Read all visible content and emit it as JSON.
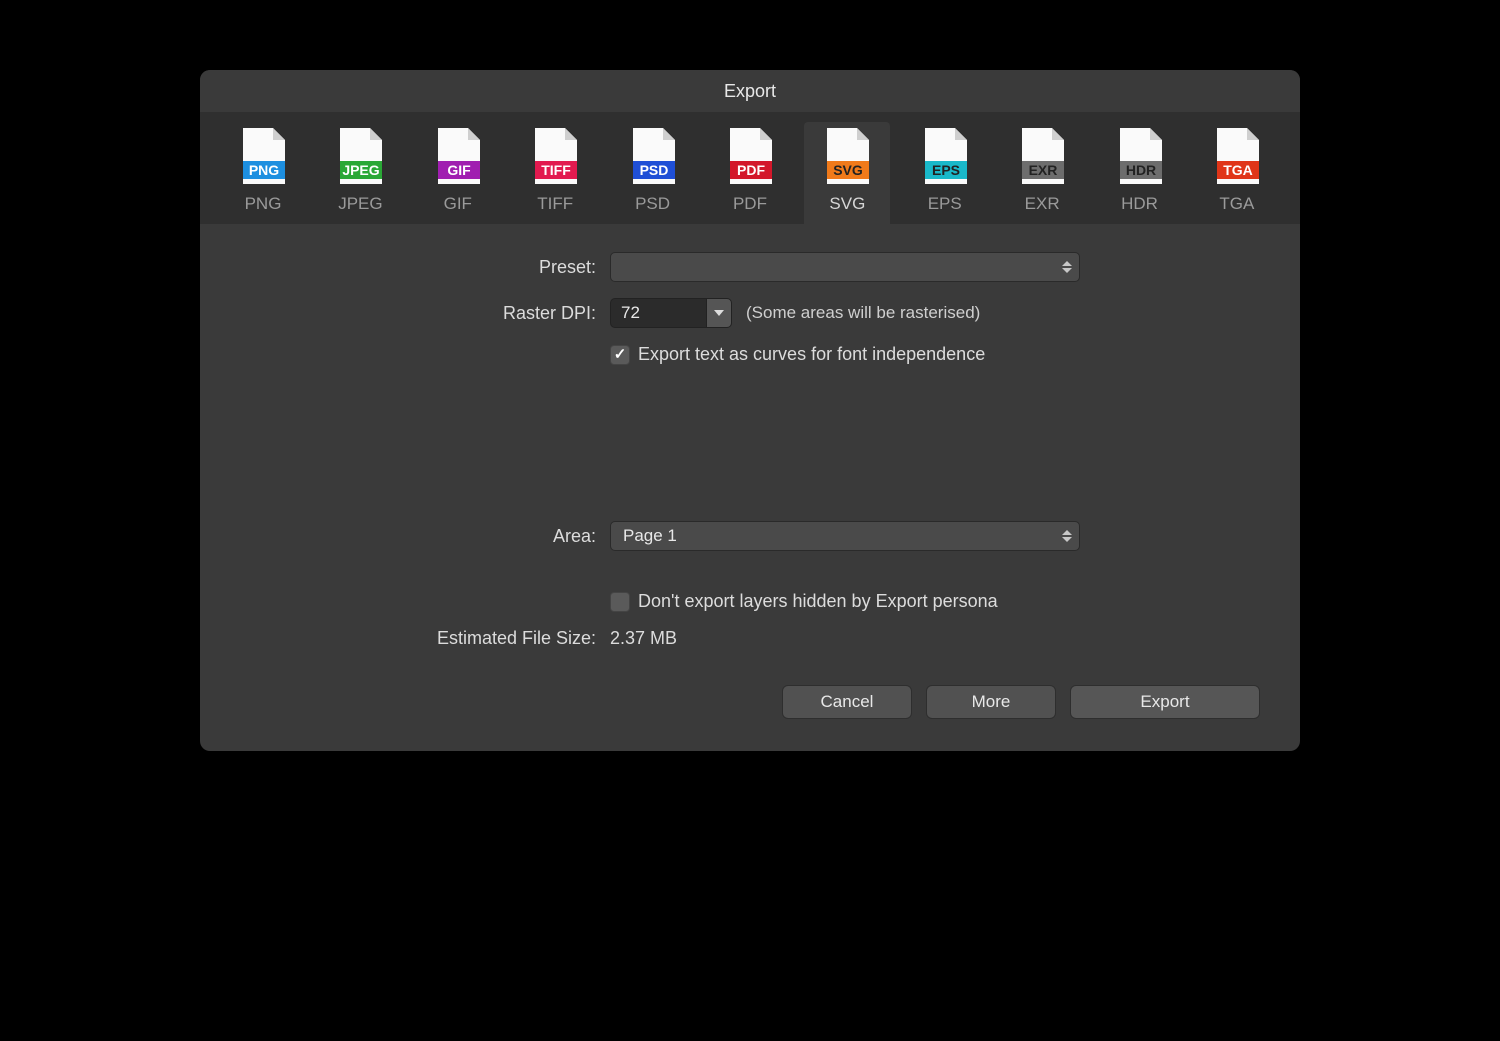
{
  "window": {
    "title": "Export"
  },
  "formats": [
    {
      "id": "png",
      "label": "PNG",
      "badge": "PNG",
      "color": "#1d8fe0",
      "text": "#fff",
      "selected": false
    },
    {
      "id": "jpeg",
      "label": "JPEG",
      "badge": "JPEG",
      "color": "#2aa836",
      "text": "#fff",
      "selected": false
    },
    {
      "id": "gif",
      "label": "GIF",
      "badge": "GIF",
      "color": "#a01eb0",
      "text": "#fff",
      "selected": false
    },
    {
      "id": "tiff",
      "label": "TIFF",
      "badge": "TIFF",
      "color": "#e21a4f",
      "text": "#fff",
      "selected": false
    },
    {
      "id": "psd",
      "label": "PSD",
      "badge": "PSD",
      "color": "#1f4fd6",
      "text": "#fff",
      "selected": false
    },
    {
      "id": "pdf",
      "label": "PDF",
      "badge": "PDF",
      "color": "#d3172a",
      "text": "#fff",
      "selected": false
    },
    {
      "id": "svg",
      "label": "SVG",
      "badge": "SVG",
      "color": "#f07a1a",
      "text": "#222",
      "selected": true
    },
    {
      "id": "eps",
      "label": "EPS",
      "badge": "EPS",
      "color": "#19b8c9",
      "text": "#222",
      "selected": false
    },
    {
      "id": "exr",
      "label": "EXR",
      "badge": "EXR",
      "color": "#6d6d6d",
      "text": "#222",
      "selected": false
    },
    {
      "id": "hdr",
      "label": "HDR",
      "badge": "HDR",
      "color": "#6d6d6d",
      "text": "#222",
      "selected": false
    },
    {
      "id": "tga",
      "label": "TGA",
      "badge": "TGA",
      "color": "#e03518",
      "text": "#fff",
      "selected": false
    }
  ],
  "form": {
    "preset_label": "Preset:",
    "preset_value": "",
    "raster_dpi_label": "Raster DPI:",
    "raster_dpi_value": "72",
    "raster_dpi_hint": "(Some areas will be rasterised)",
    "export_text_curves_label": "Export text as curves for font independence",
    "export_text_curves_checked": true,
    "area_label": "Area:",
    "area_value": "Page 1",
    "dont_export_hidden_label": "Don't export layers hidden by Export persona",
    "dont_export_hidden_checked": false,
    "est_size_label": "Estimated File Size:",
    "est_size_value": "2.37 MB"
  },
  "buttons": {
    "cancel": "Cancel",
    "more": "More",
    "export": "Export"
  }
}
